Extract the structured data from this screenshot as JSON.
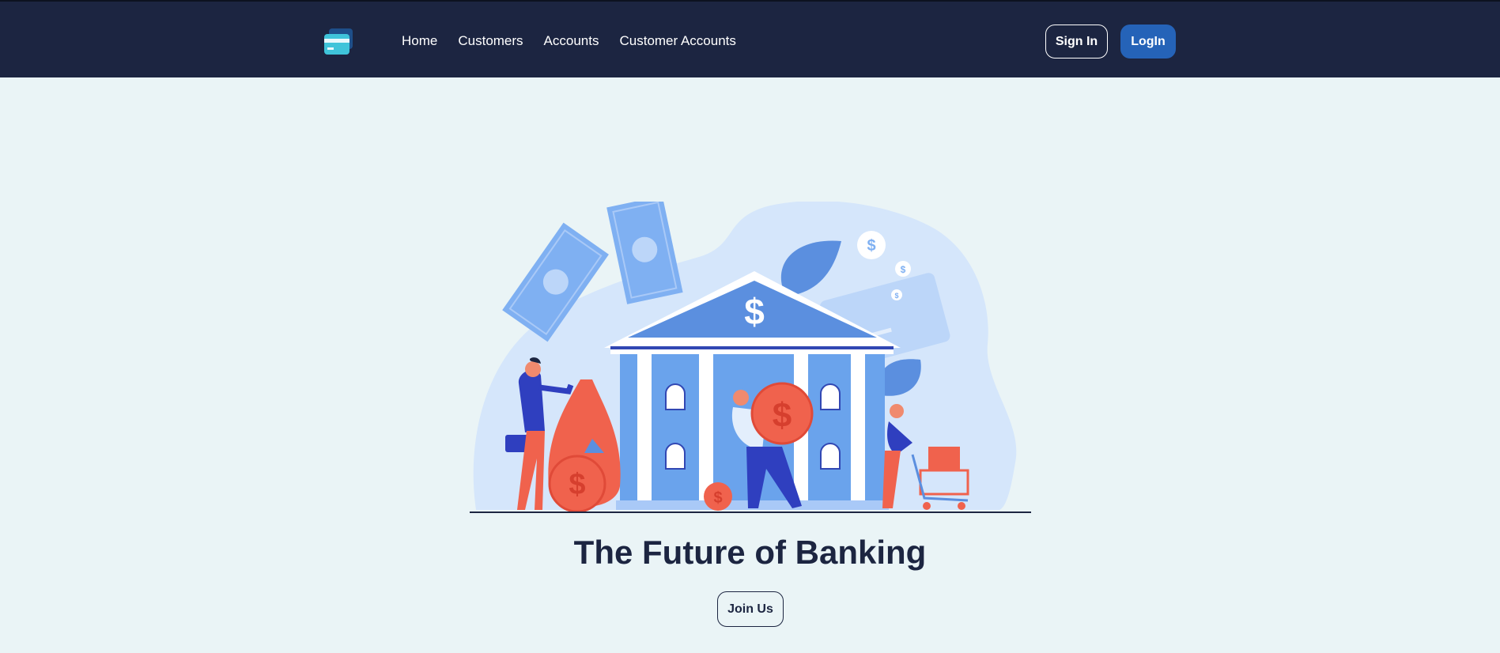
{
  "nav": {
    "logo_icon": "credit-card-icon",
    "links": [
      {
        "label": "Home"
      },
      {
        "label": "Customers"
      },
      {
        "label": "Accounts"
      },
      {
        "label": "Customer Accounts"
      }
    ],
    "signin_label": "Sign In",
    "login_label": "LogIn"
  },
  "hero": {
    "illustration": "bank-building-illustration",
    "title": "The Future of Banking",
    "cta_label": "Join Us"
  },
  "colors": {
    "navbar_bg": "#1c2541",
    "page_bg": "#eaf4f6",
    "login_bg": "#2563b8",
    "illustration_blue": "#5b8fdf",
    "illustration_red": "#f0624d"
  }
}
